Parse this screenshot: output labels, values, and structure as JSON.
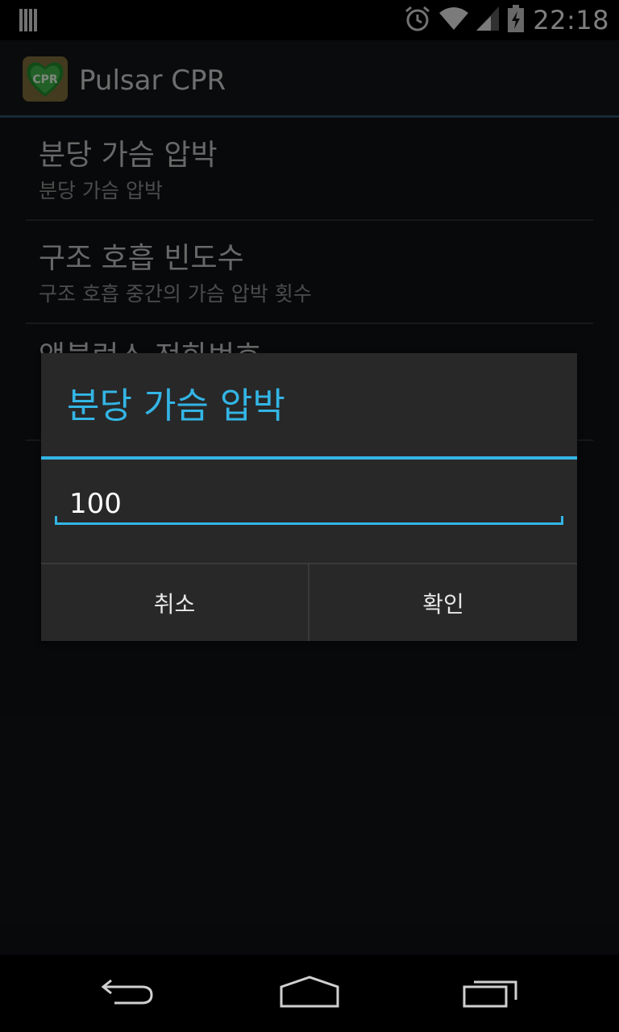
{
  "status_bar": {
    "time": "22:18",
    "icons": [
      "notification-icon",
      "alarm-icon",
      "wifi-icon",
      "signal-icon",
      "battery-charging-icon"
    ]
  },
  "action_bar": {
    "title": "Pulsar CPR",
    "icon_text": "CPR"
  },
  "preferences": [
    {
      "title": "분당 가슴 압박",
      "summary": "분당 가슴 압박"
    },
    {
      "title": "구조 호흡 빈도수",
      "summary": "구조 호흡 중간의 가슴 압박 횟수"
    },
    {
      "title": "앰뷸런스 전화번호",
      "summary": ""
    }
  ],
  "dialog": {
    "title": "분당 가슴 압박",
    "input_value": "100",
    "cancel_label": "취소",
    "ok_label": "확인"
  },
  "nav_bar": {
    "icons": [
      "back-icon",
      "home-icon",
      "recent-apps-icon"
    ]
  },
  "colors": {
    "accent": "#33b5e5",
    "dialog_bg": "#282828",
    "background": "#101214"
  }
}
